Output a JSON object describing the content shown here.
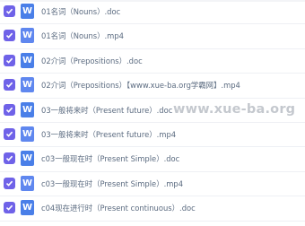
{
  "files": [
    {
      "name": "01名词（Nouns）.doc",
      "icon": "word-doc-icon",
      "checked": true
    },
    {
      "name": "01名词（Nouns）.mp4",
      "icon": "video-file-icon",
      "checked": true
    },
    {
      "name": "02介词（Prepositions）.doc",
      "icon": "word-doc-icon",
      "checked": true
    },
    {
      "name": "02介词（Prepositions）【www.xue-ba.org学霸网】.mp4",
      "icon": "video-file-icon",
      "checked": true
    },
    {
      "name": "03一般将来时（Present future）.doc",
      "icon": "word-doc-icon",
      "checked": true
    },
    {
      "name": "03一般将来时（Present future）.mp4",
      "icon": "video-file-icon",
      "checked": true
    },
    {
      "name": "c03一般现在时（Present Simple）.doc",
      "icon": "word-doc-icon",
      "checked": true
    },
    {
      "name": "c03一般现在时（Present Simple）.mp4",
      "icon": "video-file-icon",
      "checked": true
    },
    {
      "name": "c04现在进行时（Present continuous）.doc",
      "icon": "word-doc-icon",
      "checked": true
    }
  ],
  "icon_letter": "W",
  "watermark": "www.xue-ba.org",
  "colors": {
    "checkbox": "#6f62e8",
    "doc_icon": "#4a7fe8",
    "text": "#5b6b80"
  }
}
